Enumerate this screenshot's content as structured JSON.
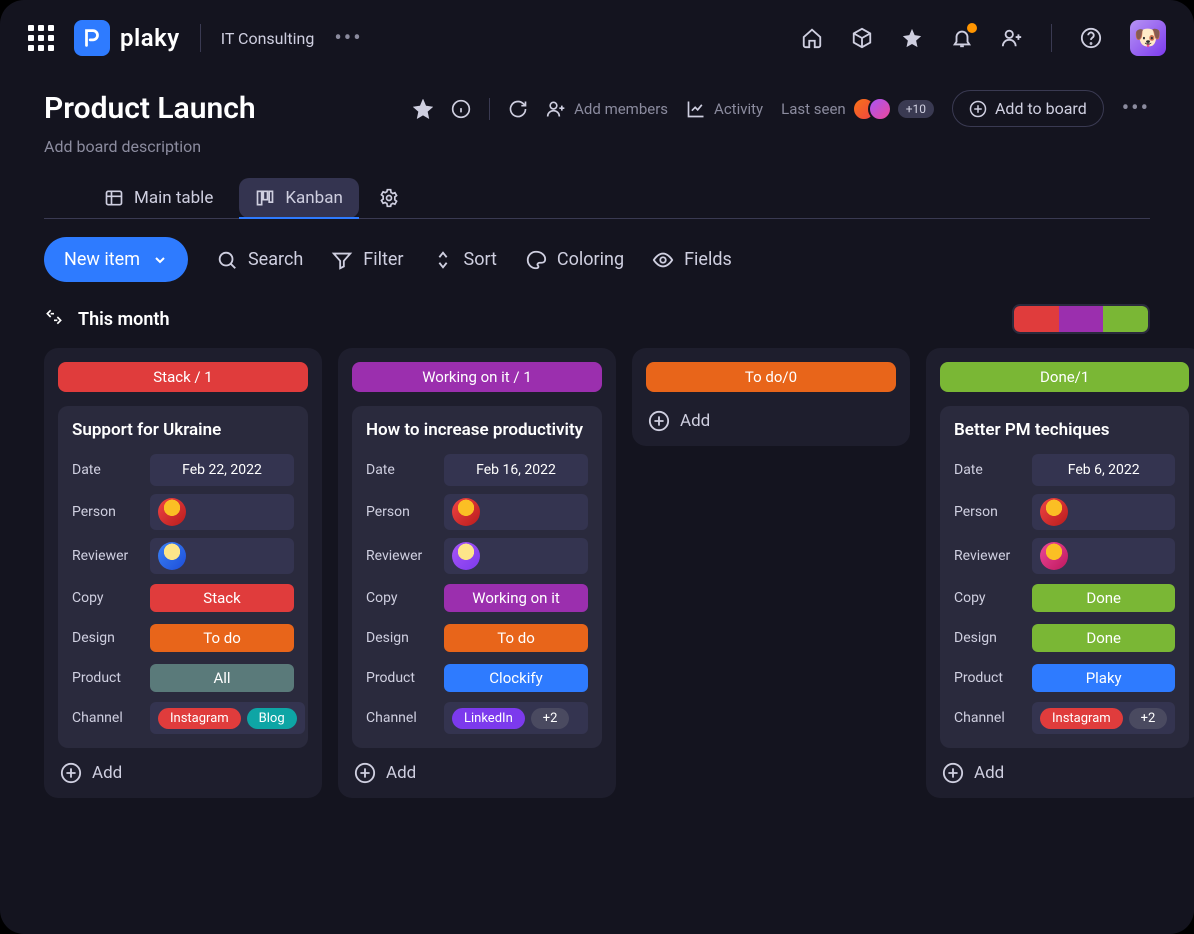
{
  "workspace": "IT Consulting",
  "logo_text": "plaky",
  "board": {
    "title": "Product Launch",
    "description_placeholder": "Add board description",
    "add_members_label": "Add members",
    "activity_label": "Activity",
    "last_seen_label": "Last seen",
    "member_overflow": "+10",
    "add_to_board_label": "Add to board"
  },
  "tabs": {
    "main_table": "Main table",
    "kanban": "Kanban"
  },
  "toolbar": {
    "new_item": "New item",
    "search": "Search",
    "filter": "Filter",
    "sort": "Sort",
    "coloring": "Coloring",
    "fields": "Fields"
  },
  "section": {
    "title": "This month"
  },
  "field_labels": {
    "date": "Date",
    "person": "Person",
    "reviewer": "Reviewer",
    "copy": "Copy",
    "design": "Design",
    "product": "Product",
    "channel": "Channel"
  },
  "columns": [
    {
      "header": "Stack / 1",
      "color": "red",
      "cards": [
        {
          "title": "Support for Ukraine",
          "date": "Feb 22, 2022",
          "person_avatar": "av1",
          "reviewer_avatar": "av2",
          "copy": {
            "label": "Stack",
            "color": "red"
          },
          "design": {
            "label": "To do",
            "color": "orange"
          },
          "product": {
            "label": "All",
            "color": "teal"
          },
          "channels": [
            {
              "label": "Instagram",
              "color": "ig"
            },
            {
              "label": "Blog",
              "color": "blog"
            }
          ]
        }
      ],
      "add_label": "Add"
    },
    {
      "header": "Working on it / 1",
      "color": "purple",
      "cards": [
        {
          "title": "How to increase productivity",
          "date": "Feb 16, 2022",
          "person_avatar": "av1",
          "reviewer_avatar": "av3",
          "copy": {
            "label": "Working on it",
            "color": "purple"
          },
          "design": {
            "label": "To do",
            "color": "orange"
          },
          "product": {
            "label": "Clockify",
            "color": "blue"
          },
          "channels": [
            {
              "label": "LinkedIn",
              "color": "li"
            },
            {
              "label": "+2",
              "color": "more"
            }
          ]
        }
      ],
      "add_label": "Add"
    },
    {
      "header": "To do/0",
      "color": "orange",
      "cards": [],
      "add_label": "Add"
    },
    {
      "header": "Done/1",
      "color": "green",
      "cards": [
        {
          "title": "Better PM techiques",
          "date": "Feb 6, 2022",
          "person_avatar": "av1",
          "reviewer_avatar": "av4",
          "copy": {
            "label": "Done",
            "color": "green"
          },
          "design": {
            "label": "Done",
            "color": "green"
          },
          "product": {
            "label": "Plaky",
            "color": "blue"
          },
          "channels": [
            {
              "label": "Instagram",
              "color": "ig"
            },
            {
              "label": "+2",
              "color": "more"
            }
          ]
        }
      ],
      "add_label": "Add"
    }
  ]
}
